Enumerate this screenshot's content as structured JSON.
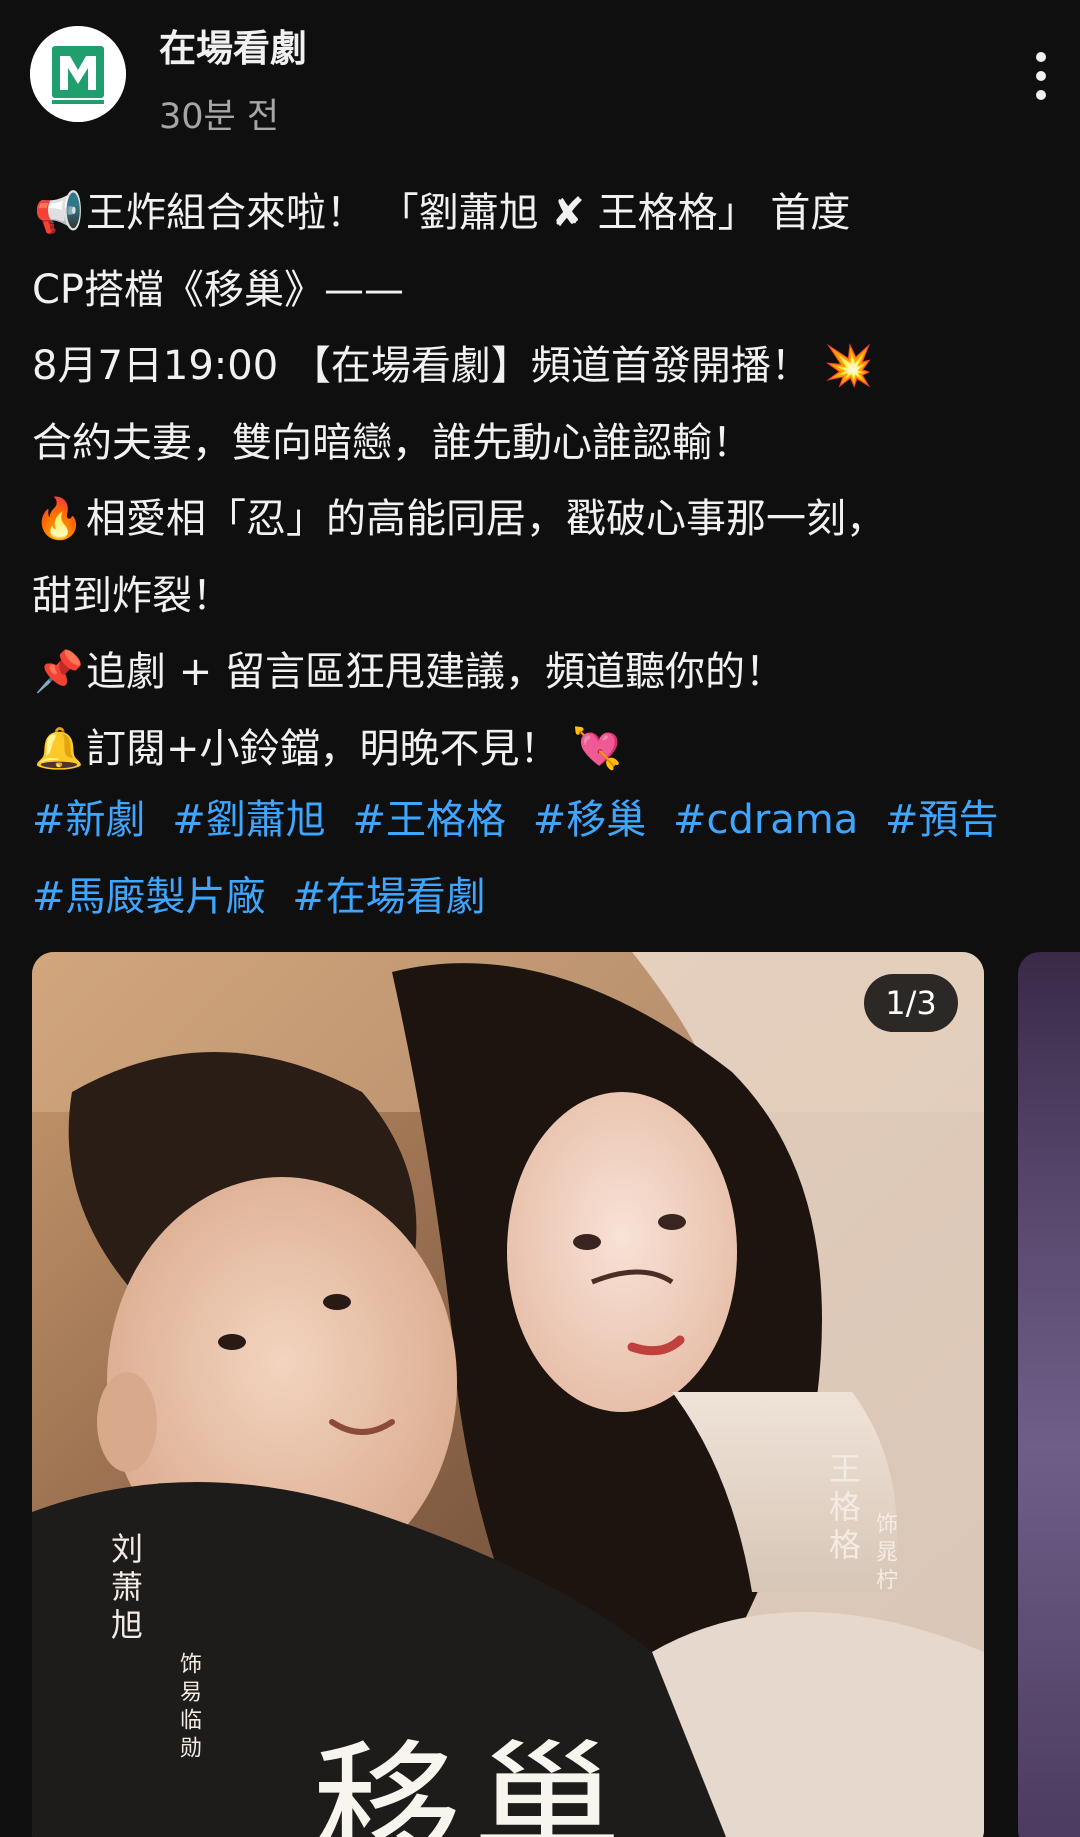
{
  "post": {
    "channel_name": "在場看劇",
    "time_ago": "30분 전",
    "lines": [
      {
        "emoji": "📢",
        "emoji_name": "megaphone-icon",
        "text": "王炸組合來啦！ 「劉蕭旭 ✘ 王格格」 首度"
      },
      {
        "emoji": "",
        "emoji_name": "",
        "text": "CP搭檔《移巢》——"
      },
      {
        "emoji": "",
        "emoji_name": "",
        "text": "8月7日19:00 【在場看劇】頻道首發開播！ 💥"
      },
      {
        "emoji": "",
        "emoji_name": "",
        "text": "合約夫妻，雙向暗戀，誰先動心誰認輸！"
      },
      {
        "emoji": "🔥",
        "emoji_name": "fire-icon",
        "text": "相愛相「忍」的高能同居，戳破心事那一刻，"
      },
      {
        "emoji": "",
        "emoji_name": "",
        "text": "甜到炸裂！"
      },
      {
        "emoji": "📌",
        "emoji_name": "pushpin-icon",
        "text": "追劇 + 留言區狂甩建議，頻道聽你的！"
      },
      {
        "emoji": "🔔",
        "emoji_name": "bell-icon",
        "text": "訂閱+小鈴鐺，明晚不見！ 💘"
      }
    ],
    "hashtags": [
      "#新劇",
      "#劉蕭旭",
      "#王格格",
      "#移巢",
      "#cdrama",
      "#預告",
      "#馬廄製片廠",
      "#在場看劇"
    ]
  },
  "carousel": {
    "counter": "1/3",
    "poster": {
      "name_male": "刘萧旭",
      "role_male": "饰易临勋",
      "name_female": "王格格",
      "role_female": "饰晁柠",
      "title": "移巢"
    }
  },
  "colors": {
    "background": "#0f0f0f",
    "text": "#f1f1f1",
    "secondary_text": "#a6a6a6",
    "hashtag": "#3ea6ff",
    "logo": "#1f9e6e"
  },
  "icons": {
    "more": "more-vertical-icon",
    "avatar": "channel-logo-icon"
  }
}
